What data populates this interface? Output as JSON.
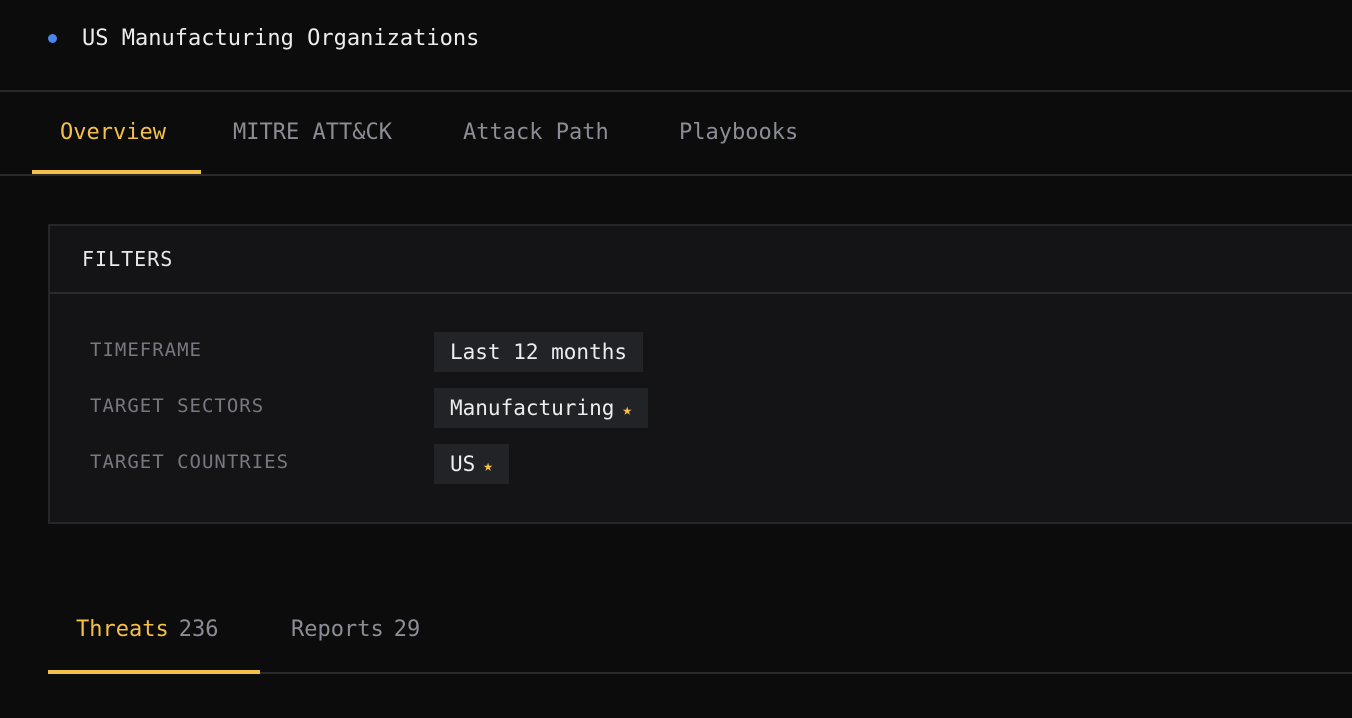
{
  "header": {
    "title": "US Manufacturing Organizations",
    "dot_color": "#4a86e8"
  },
  "tabs": [
    {
      "label": "Overview",
      "active": true
    },
    {
      "label": "MITRE ATT&CK",
      "active": false
    },
    {
      "label": "Attack Path",
      "active": false
    },
    {
      "label": "Playbooks",
      "active": false
    }
  ],
  "filters": {
    "title": "FILTERS",
    "rows": [
      {
        "label": "TIMEFRAME",
        "value": "Last 12 months",
        "starred": false
      },
      {
        "label": "TARGET SECTORS",
        "value": "Manufacturing",
        "starred": true
      },
      {
        "label": "TARGET COUNTRIES",
        "value": "US",
        "starred": true
      }
    ],
    "star_glyph": "★"
  },
  "subtabs": [
    {
      "label": "Threats",
      "count": "236",
      "active": true
    },
    {
      "label": "Reports",
      "count": "29",
      "active": false
    }
  ],
  "colors": {
    "accent": "#f5c04a",
    "background": "#0c0c0d",
    "panel": "#141416"
  }
}
